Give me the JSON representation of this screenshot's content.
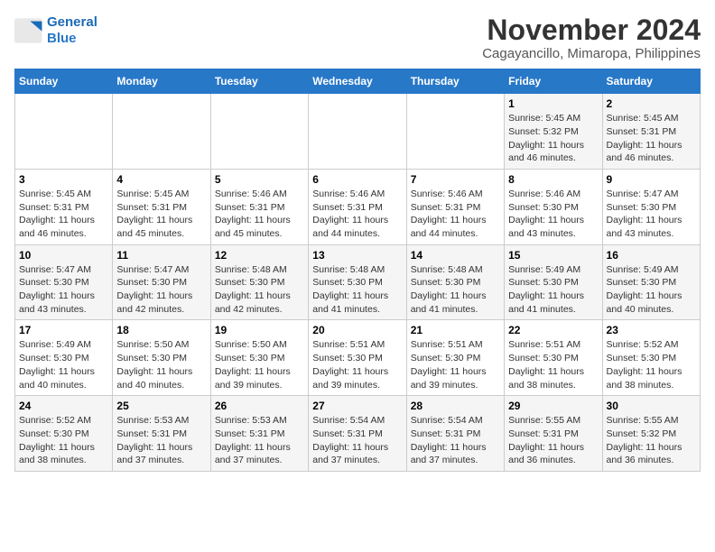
{
  "header": {
    "logo_line1": "General",
    "logo_line2": "Blue",
    "month_year": "November 2024",
    "location": "Cagayancillo, Mimaropa, Philippines"
  },
  "days_of_week": [
    "Sunday",
    "Monday",
    "Tuesday",
    "Wednesday",
    "Thursday",
    "Friday",
    "Saturday"
  ],
  "weeks": [
    [
      {
        "day": "",
        "info": ""
      },
      {
        "day": "",
        "info": ""
      },
      {
        "day": "",
        "info": ""
      },
      {
        "day": "",
        "info": ""
      },
      {
        "day": "",
        "info": ""
      },
      {
        "day": "1",
        "info": "Sunrise: 5:45 AM\nSunset: 5:32 PM\nDaylight: 11 hours and 46 minutes."
      },
      {
        "day": "2",
        "info": "Sunrise: 5:45 AM\nSunset: 5:31 PM\nDaylight: 11 hours and 46 minutes."
      }
    ],
    [
      {
        "day": "3",
        "info": "Sunrise: 5:45 AM\nSunset: 5:31 PM\nDaylight: 11 hours and 46 minutes."
      },
      {
        "day": "4",
        "info": "Sunrise: 5:45 AM\nSunset: 5:31 PM\nDaylight: 11 hours and 45 minutes."
      },
      {
        "day": "5",
        "info": "Sunrise: 5:46 AM\nSunset: 5:31 PM\nDaylight: 11 hours and 45 minutes."
      },
      {
        "day": "6",
        "info": "Sunrise: 5:46 AM\nSunset: 5:31 PM\nDaylight: 11 hours and 44 minutes."
      },
      {
        "day": "7",
        "info": "Sunrise: 5:46 AM\nSunset: 5:31 PM\nDaylight: 11 hours and 44 minutes."
      },
      {
        "day": "8",
        "info": "Sunrise: 5:46 AM\nSunset: 5:30 PM\nDaylight: 11 hours and 43 minutes."
      },
      {
        "day": "9",
        "info": "Sunrise: 5:47 AM\nSunset: 5:30 PM\nDaylight: 11 hours and 43 minutes."
      }
    ],
    [
      {
        "day": "10",
        "info": "Sunrise: 5:47 AM\nSunset: 5:30 PM\nDaylight: 11 hours and 43 minutes."
      },
      {
        "day": "11",
        "info": "Sunrise: 5:47 AM\nSunset: 5:30 PM\nDaylight: 11 hours and 42 minutes."
      },
      {
        "day": "12",
        "info": "Sunrise: 5:48 AM\nSunset: 5:30 PM\nDaylight: 11 hours and 42 minutes."
      },
      {
        "day": "13",
        "info": "Sunrise: 5:48 AM\nSunset: 5:30 PM\nDaylight: 11 hours and 41 minutes."
      },
      {
        "day": "14",
        "info": "Sunrise: 5:48 AM\nSunset: 5:30 PM\nDaylight: 11 hours and 41 minutes."
      },
      {
        "day": "15",
        "info": "Sunrise: 5:49 AM\nSunset: 5:30 PM\nDaylight: 11 hours and 41 minutes."
      },
      {
        "day": "16",
        "info": "Sunrise: 5:49 AM\nSunset: 5:30 PM\nDaylight: 11 hours and 40 minutes."
      }
    ],
    [
      {
        "day": "17",
        "info": "Sunrise: 5:49 AM\nSunset: 5:30 PM\nDaylight: 11 hours and 40 minutes."
      },
      {
        "day": "18",
        "info": "Sunrise: 5:50 AM\nSunset: 5:30 PM\nDaylight: 11 hours and 40 minutes."
      },
      {
        "day": "19",
        "info": "Sunrise: 5:50 AM\nSunset: 5:30 PM\nDaylight: 11 hours and 39 minutes."
      },
      {
        "day": "20",
        "info": "Sunrise: 5:51 AM\nSunset: 5:30 PM\nDaylight: 11 hours and 39 minutes."
      },
      {
        "day": "21",
        "info": "Sunrise: 5:51 AM\nSunset: 5:30 PM\nDaylight: 11 hours and 39 minutes."
      },
      {
        "day": "22",
        "info": "Sunrise: 5:51 AM\nSunset: 5:30 PM\nDaylight: 11 hours and 38 minutes."
      },
      {
        "day": "23",
        "info": "Sunrise: 5:52 AM\nSunset: 5:30 PM\nDaylight: 11 hours and 38 minutes."
      }
    ],
    [
      {
        "day": "24",
        "info": "Sunrise: 5:52 AM\nSunset: 5:30 PM\nDaylight: 11 hours and 38 minutes."
      },
      {
        "day": "25",
        "info": "Sunrise: 5:53 AM\nSunset: 5:31 PM\nDaylight: 11 hours and 37 minutes."
      },
      {
        "day": "26",
        "info": "Sunrise: 5:53 AM\nSunset: 5:31 PM\nDaylight: 11 hours and 37 minutes."
      },
      {
        "day": "27",
        "info": "Sunrise: 5:54 AM\nSunset: 5:31 PM\nDaylight: 11 hours and 37 minutes."
      },
      {
        "day": "28",
        "info": "Sunrise: 5:54 AM\nSunset: 5:31 PM\nDaylight: 11 hours and 37 minutes."
      },
      {
        "day": "29",
        "info": "Sunrise: 5:55 AM\nSunset: 5:31 PM\nDaylight: 11 hours and 36 minutes."
      },
      {
        "day": "30",
        "info": "Sunrise: 5:55 AM\nSunset: 5:32 PM\nDaylight: 11 hours and 36 minutes."
      }
    ]
  ]
}
